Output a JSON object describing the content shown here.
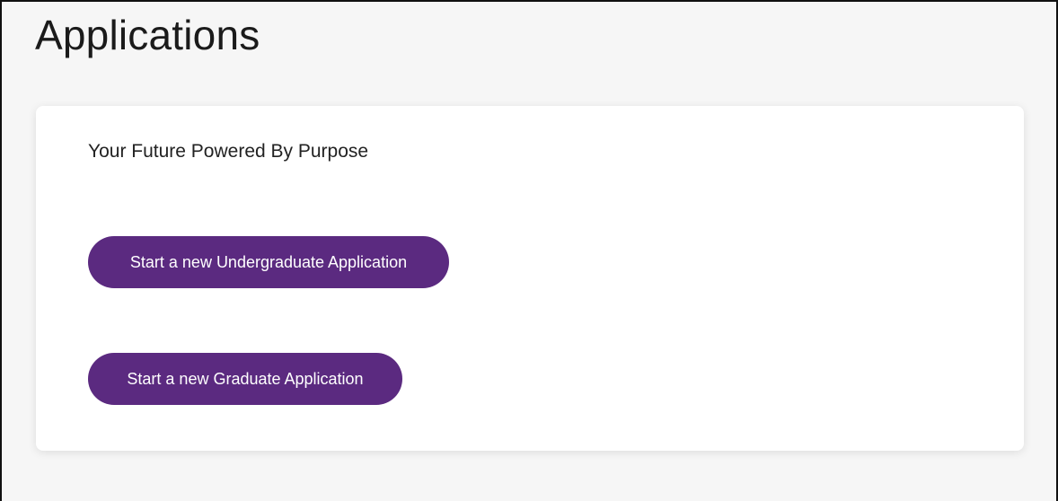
{
  "page": {
    "title": "Applications"
  },
  "card": {
    "tagline": "Your Future Powered By Purpose",
    "buttons": {
      "undergraduate": "Start a new Undergraduate Application",
      "graduate": "Start a new Graduate Application"
    }
  },
  "colors": {
    "page_background": "#f6f6f6",
    "card_background": "#ffffff",
    "button_background": "#5b2a80",
    "button_text": "#ffffff"
  }
}
